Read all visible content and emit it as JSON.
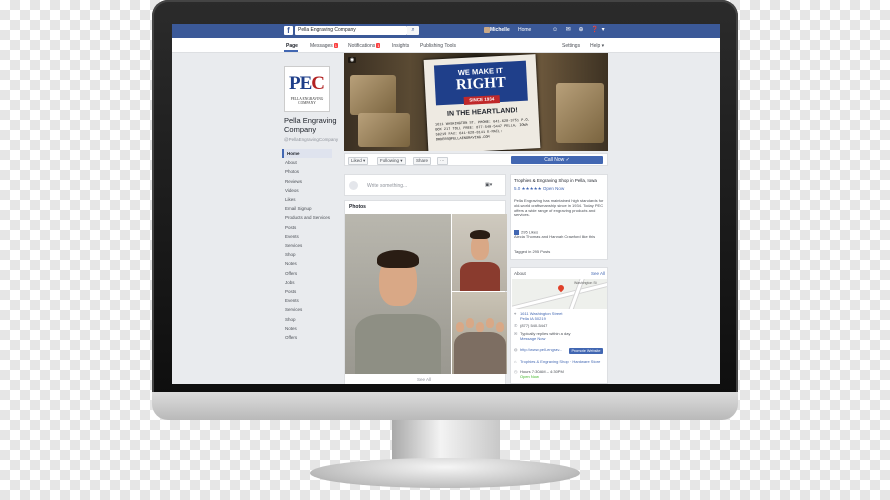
{
  "topbar": {
    "search_value": "Pella Engraving Company",
    "user_name": "Michelle",
    "home_label": "Home"
  },
  "page_nav": {
    "tabs": [
      {
        "label": "Page",
        "active": true
      },
      {
        "label": "Messages",
        "badge": "1"
      },
      {
        "label": "Notifications",
        "badge": "1"
      },
      {
        "label": "Insights"
      },
      {
        "label": "Publishing Tools"
      },
      {
        "label": "Settings"
      },
      {
        "label": "Help ▾"
      }
    ]
  },
  "logo": {
    "letters_a": "PE",
    "letters_b": "C",
    "sub": "PELLA ENGRAVING COMPANY"
  },
  "page_info": {
    "name": "Pella Engraving Company",
    "handle": "@PellaEngravingCompany"
  },
  "left_nav": [
    "Home",
    "About",
    "Photos",
    "Reviews",
    "Videos",
    "Likes",
    "Email Signup",
    "Products and Services",
    "Posts",
    "Events",
    "Services",
    "Shop",
    "Notes",
    "Offers",
    "Jobs",
    "Posts",
    "Events",
    "Services",
    "Shop",
    "Notes",
    "Offers"
  ],
  "cover": {
    "line1": "WE MAKE IT",
    "line2": "RIGHT",
    "since": "SINCE 1934",
    "heartland": "IN THE HEARTLAND!",
    "address": "1611 WASHINGTON ST. PHONE: 641-628-3751  P.O. BOX 217  TOLL FREE: 877-540-5447  PELLA, IOWA 50219  FAX: 641-628-8141  E-MAIL: ORDERS@PELLAENGRAVING.COM"
  },
  "actions": {
    "liked": "Liked ▾",
    "following": "Following ▾",
    "share": "Share",
    "more": "···",
    "call_now": "Call Now ✓"
  },
  "composer": {
    "placeholder": "Write something...",
    "icon": "▣▾"
  },
  "photos": {
    "title": "Photos",
    "see_all": "See All"
  },
  "right_card": {
    "title": "Trophies & Engraving Shop in Pella, Iowa",
    "rating": "5.0 ★★★★★  Open Now",
    "about": "Pella Engraving has maintained high standards for old-world craftsmanship since in 1934. Today PEC offers a wide range of engraving products and services.",
    "likes_count": "295 Likes",
    "likes_friends": "Alecia Thomas and Hannah Crawford like this",
    "tagged": "Tagged in 295 Posts"
  },
  "about_card": {
    "title": "About",
    "see_all": "See All",
    "address": "1611 Washington Street",
    "city": "Pella IA 50219",
    "phone": "(877) 540-5447",
    "reply": "Typically replies within a day",
    "message": "Message Now",
    "website": "http://www.pell-engrav...",
    "promote": "Promote Website",
    "category": "Trophies & Engraving Shop · Hardware Store",
    "hours": "Hours 7:30AM – 4:30PM",
    "open": "Open Now"
  },
  "map": {
    "street_label": "Washington St"
  },
  "colors": {
    "facebook_blue": "#3b5998",
    "button_blue": "#4267b2",
    "logo_red": "#b22222",
    "logo_blue": "#1f3f8a"
  }
}
